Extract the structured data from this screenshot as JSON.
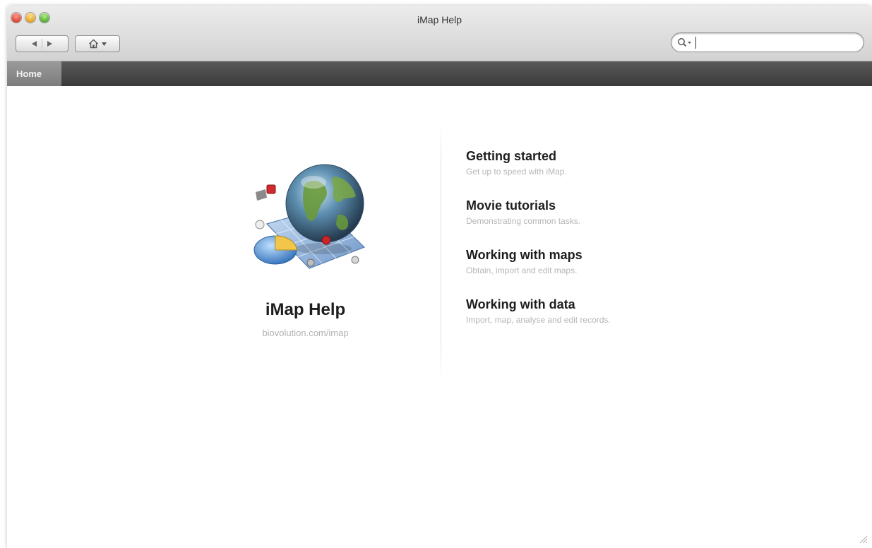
{
  "window": {
    "title": "iMap Help"
  },
  "toolbar": {
    "back_icon": "triangle-left-icon",
    "forward_icon": "triangle-right-icon",
    "home_icon": "house-icon",
    "search": {
      "placeholder": "",
      "value": ""
    }
  },
  "tabs": [
    {
      "label": "Home",
      "selected": true
    }
  ],
  "app": {
    "title": "iMap Help",
    "url": "biovolution.com/imap"
  },
  "topics": [
    {
      "title": "Getting started",
      "description": "Get up to speed with iMap."
    },
    {
      "title": "Movie tutorials",
      "description": "Demonstrating common tasks."
    },
    {
      "title": "Working with maps",
      "description": "Obtain, import and edit maps."
    },
    {
      "title": "Working with data",
      "description": "Import, map, analyse and edit records."
    }
  ],
  "colors": {
    "tabbar": "#3f3f3f",
    "tab_selected": "#8a8a8a",
    "heading": "#1e1e1e",
    "subtle_text": "#b6b6b6"
  }
}
